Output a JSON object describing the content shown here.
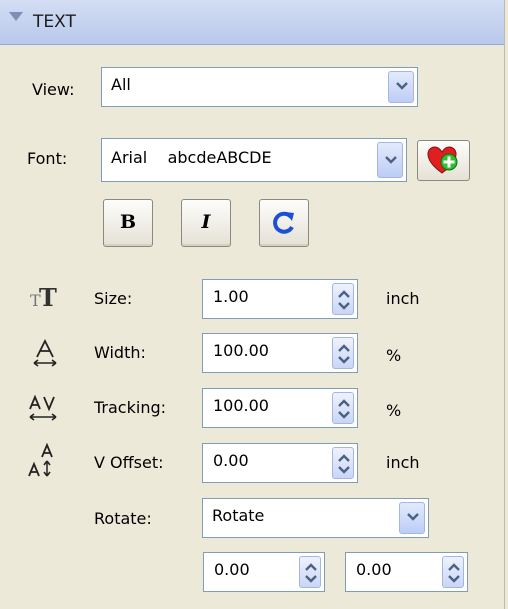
{
  "header": {
    "title": "TEXT"
  },
  "view": {
    "label": "View:",
    "value": "All"
  },
  "font": {
    "label": "Font:",
    "value": "Arial    abcdeABCDE"
  },
  "style_buttons": {
    "bold": "B",
    "italic": "I"
  },
  "rows": {
    "size": {
      "label": "Size:",
      "value": "1.00",
      "unit": "inch"
    },
    "width": {
      "label": "Width:",
      "value": "100.00",
      "unit": "%"
    },
    "tracking": {
      "label": "Tracking:",
      "value": "100.00",
      "unit": "%"
    },
    "voffset": {
      "label": "V Offset:",
      "value": "0.00",
      "unit": "inch"
    }
  },
  "rotate": {
    "label": "Rotate:",
    "value": "Rotate",
    "x": "0.00",
    "y": "0.00"
  },
  "colors": {
    "header_bg": "#c3d0ef",
    "panel_bg": "#ece9d8",
    "field_border": "#7f9db9",
    "heart": "#e02020",
    "plus": "#2fbf2f",
    "refresh": "#1c4fd8"
  },
  "icons": [
    "collapse-triangle-icon",
    "dropdown-arrow-icon",
    "add-favorite-icon",
    "bold-icon",
    "italic-icon",
    "reset-icon",
    "text-size-icon",
    "text-width-icon",
    "tracking-icon",
    "v-offset-icon",
    "spinner-icon"
  ]
}
